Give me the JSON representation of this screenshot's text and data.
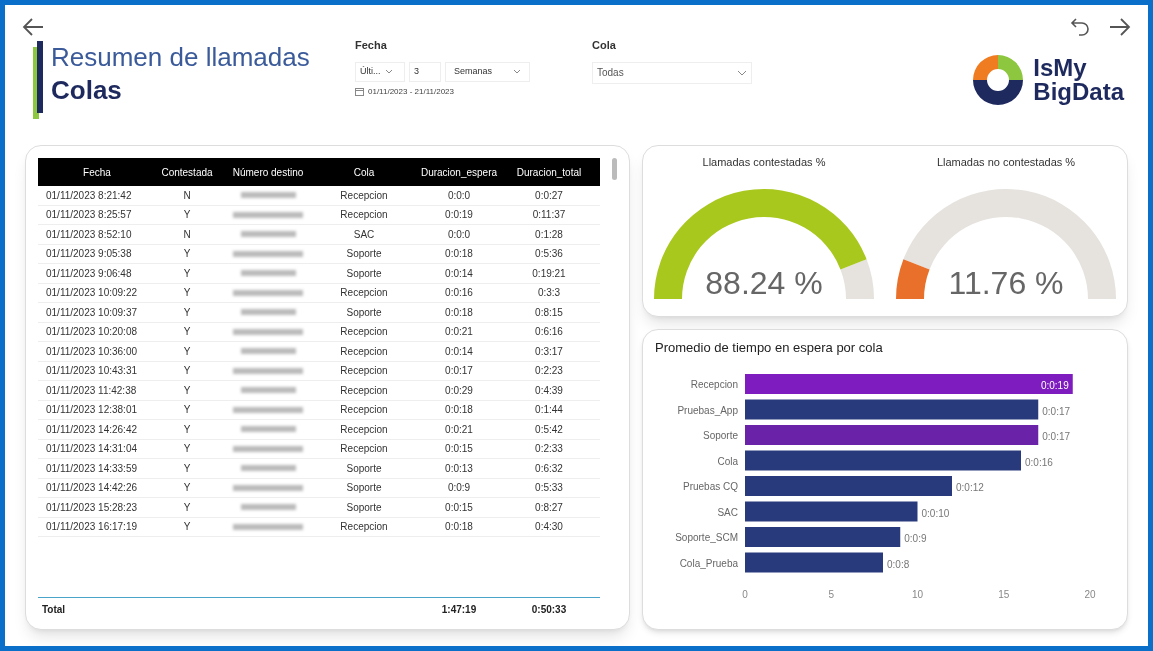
{
  "header": {
    "title": "Resumen de llamadas",
    "subtitle": "Colas"
  },
  "filters": {
    "fecha": {
      "label": "Fecha",
      "mode": "Últi...",
      "count": "3",
      "unit": "Semanas",
      "range": "01/11/2023 - 21/11/2023"
    },
    "cola": {
      "label": "Cola",
      "value": "Todas"
    }
  },
  "logo": {
    "line1": "IsMy",
    "line2": "BigData"
  },
  "table": {
    "columns": [
      "Fecha",
      "Contestada",
      "Número destino",
      "Cola",
      "Duracion_espera",
      "Duracion_total"
    ],
    "rows": [
      [
        "01/11/2023 8:21:42",
        "N",
        "",
        "Recepcion",
        "0:0:0",
        "0:0:27"
      ],
      [
        "01/11/2023 8:25:57",
        "Y",
        "",
        "Recepcion",
        "0:0:19",
        "0:11:37"
      ],
      [
        "01/11/2023 8:52:10",
        "N",
        "",
        "SAC",
        "0:0:0",
        "0:1:28"
      ],
      [
        "01/11/2023 9:05:38",
        "Y",
        "",
        "Soporte",
        "0:0:18",
        "0:5:36"
      ],
      [
        "01/11/2023 9:06:48",
        "Y",
        "",
        "Soporte",
        "0:0:14",
        "0:19:21"
      ],
      [
        "01/11/2023 10:09:22",
        "Y",
        "",
        "Recepcion",
        "0:0:16",
        "0:3:3"
      ],
      [
        "01/11/2023 10:09:37",
        "Y",
        "",
        "Soporte",
        "0:0:18",
        "0:8:15"
      ],
      [
        "01/11/2023 10:20:08",
        "Y",
        "",
        "Recepcion",
        "0:0:21",
        "0:6:16"
      ],
      [
        "01/11/2023 10:36:00",
        "Y",
        "",
        "Recepcion",
        "0:0:14",
        "0:3:17"
      ],
      [
        "01/11/2023 10:43:31",
        "Y",
        "",
        "Recepcion",
        "0:0:17",
        "0:2:23"
      ],
      [
        "01/11/2023 11:42:38",
        "Y",
        "",
        "Recepcion",
        "0:0:29",
        "0:4:39"
      ],
      [
        "01/11/2023 12:38:01",
        "Y",
        "",
        "Recepcion",
        "0:0:18",
        "0:1:44"
      ],
      [
        "01/11/2023 14:26:42",
        "Y",
        "",
        "Recepcion",
        "0:0:21",
        "0:5:42"
      ],
      [
        "01/11/2023 14:31:04",
        "Y",
        "",
        "Recepcion",
        "0:0:15",
        "0:2:33"
      ],
      [
        "01/11/2023 14:33:59",
        "Y",
        "",
        "Soporte",
        "0:0:13",
        "0:6:32"
      ],
      [
        "01/11/2023 14:42:26",
        "Y",
        "",
        "Soporte",
        "0:0:9",
        "0:5:33"
      ],
      [
        "01/11/2023 15:28:23",
        "Y",
        "",
        "Soporte",
        "0:0:15",
        "0:8:27"
      ],
      [
        "01/11/2023 16:17:19",
        "Y",
        "",
        "Recepcion",
        "0:0:18",
        "0:4:30"
      ]
    ],
    "total": {
      "label": "Total",
      "espera": "1:47:19",
      "total": "0:50:33"
    }
  },
  "gauges": [
    {
      "title": "Llamadas contestadas %",
      "value": "88.24 %",
      "color": "#a8c81e"
    },
    {
      "title": "Llamadas no contestadas %",
      "value": "11.76 %",
      "color": "#e8702a"
    }
  ],
  "bar_chart": {
    "bars": [
      {
        "color": "#7e1cc0"
      },
      {
        "color": "#283a7c"
      },
      {
        "color": "#6a22a8"
      },
      {
        "color": "#283a7c"
      },
      {
        "color": "#283a7c"
      },
      {
        "color": "#283a7c"
      },
      {
        "color": "#283a7c"
      },
      {
        "color": "#283a7c"
      }
    ],
    "chart_data": {
      "type": "bar",
      "orientation": "horizontal",
      "title": "Promedio de tiempo en espera por cola",
      "categories": [
        "Recepcion",
        "Pruebas_App",
        "Soporte",
        "Cola",
        "Pruebas CQ",
        "SAC",
        "Soporte_SCM",
        "Cola_Prueba"
      ],
      "values": [
        19,
        17,
        17,
        16,
        12,
        10,
        9,
        8
      ],
      "value_labels": [
        "0:0:19",
        "0:0:17",
        "0:0:17",
        "0:0:16",
        "0:0:12",
        "0:0:10",
        "0:0:9",
        "0:0:8"
      ],
      "xlim": [
        0,
        20
      ],
      "xticks": [
        0,
        5,
        10,
        15,
        20
      ]
    }
  }
}
